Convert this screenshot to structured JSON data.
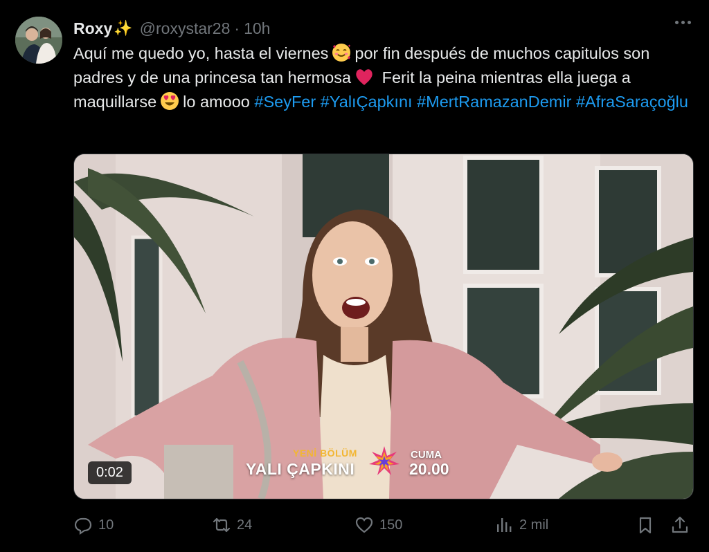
{
  "author": {
    "name": "Roxy",
    "badge_emoji": "✨",
    "handle": "@roxystar28",
    "separator": "·",
    "time": "10h"
  },
  "tweet": {
    "text_1": "Aquí me quedo yo, hasta el viernes",
    "text_2": "por fin después de muchos capitulos son padres y de una princesa tan hermosa",
    "text_3": "Ferit la peina mientras ella juega a maquillarse",
    "text_4": "lo amooo",
    "hashtags": [
      "#SeyFer",
      "#YalıÇapkını",
      "#MertRamazanDemir",
      "#AfraSaraçoğlu"
    ]
  },
  "media": {
    "duration": "0:02",
    "overlay_new_episode": "YENİ BÖLÜM",
    "overlay_show": "YALI ÇAPKINI",
    "overlay_day": "CUMA",
    "overlay_time": "20.00"
  },
  "actions": {
    "replies": "10",
    "reposts": "24",
    "likes": "150",
    "views": "2 mil"
  },
  "colors": {
    "background": "#000000",
    "text": "#e7e9ea",
    "muted": "#71767b",
    "link": "#1d9bf0"
  },
  "icons": [
    "more-icon",
    "reply-icon",
    "repost-icon",
    "like-icon",
    "views-icon",
    "bookmark-icon",
    "share-icon"
  ]
}
